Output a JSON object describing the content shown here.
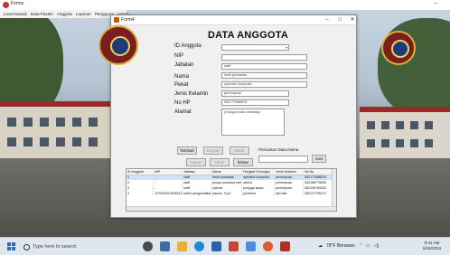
{
  "parent_app": {
    "title": "Forms",
    "menu": [
      "Level Masuk",
      "Data Pasien",
      "Anggota",
      "Laporan",
      "Pengguna",
      "Admin"
    ],
    "minimize_glyph": "–"
  },
  "window": {
    "title": "Form4",
    "controls": {
      "minimize": "–",
      "maximize": "□",
      "close": "✕"
    }
  },
  "form": {
    "heading": "DATA ANGGOTA",
    "fields": [
      {
        "label": "ID Anggota",
        "value": "",
        "kind": "select"
      },
      {
        "label": "NIP",
        "value": ""
      },
      {
        "label": "Jabatan",
        "value": "staff"
      },
      {
        "label": "Nama",
        "value": "hesti pramadia"
      },
      {
        "label": "Pekat",
        "value": "operator komputer"
      },
      {
        "label": "Jenis Kelamin",
        "value": "perempuan"
      },
      {
        "label": "No HP",
        "value": "082177666519"
      },
      {
        "label": "Alamat",
        "value": "jl.bunga indah sedalaya"
      }
    ],
    "buttons": {
      "tambah": "Tambah",
      "simpan": "Simpan",
      "batal": "Batal",
      "hapus": "Hapus",
      "edit": "Ubah",
      "keluar": "keluar",
      "cari": "Cari"
    },
    "search_label": "Pencarian Data Nama"
  },
  "grid": {
    "columns": [
      "ID Anggota",
      "NIP",
      "Jabatan",
      "Nama",
      "Pangkat Golongan",
      "Jenis Kelamin",
      "No Hp"
    ],
    "rows": [
      [
        "1",
        "-",
        "staff",
        "hesti pramadia",
        "operator komputer",
        "perempuan",
        "082177666519"
      ],
      [
        "2",
        "-",
        "staff",
        "puspa purnama sari",
        "admin",
        "perempuan",
        "082188776655"
      ],
      [
        "3",
        "-",
        "staff",
        "yasmin",
        "penjaga lapan",
        "perempuan",
        "082199765432"
      ],
      [
        "4",
        "197003201993031",
        "kabid pengendalian",
        "parsun, S.pd",
        "pembina",
        "laki-laki",
        "082127795471"
      ]
    ]
  },
  "taskbar": {
    "search_placeholder": "Type here to search",
    "weather": "78°F Berawan",
    "time": "9:41 AM",
    "date": "6/16/2023"
  },
  "colors": {
    "selection": "#cfe3f7",
    "accent": "#1d6fc9"
  }
}
